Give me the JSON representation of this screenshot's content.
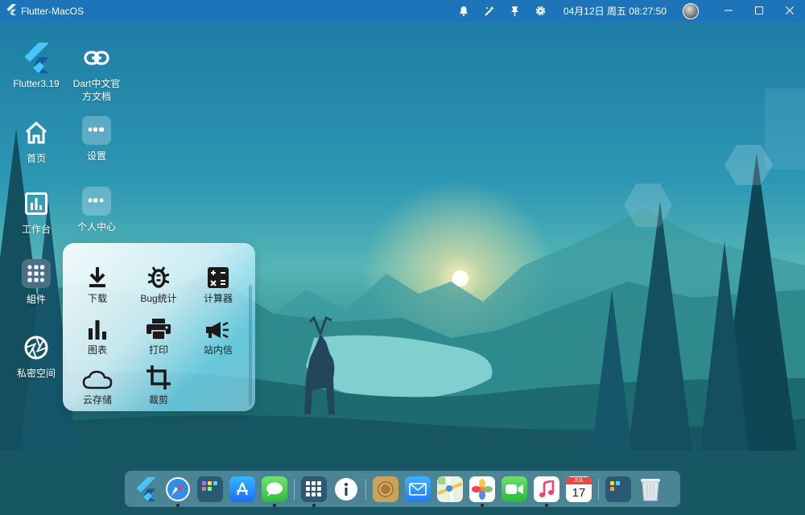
{
  "titlebar": {
    "title": "Flutter-MacOS",
    "clock": "04月12日 周五 08:27:50",
    "icons": [
      "bell-icon",
      "magic-wand-icon",
      "pin-icon",
      "gear-icon"
    ]
  },
  "desktop": {
    "icons": [
      {
        "name": "flutter",
        "label": "Flutter3.19",
        "icon": "flutter-logo-icon"
      },
      {
        "name": "dart-docs",
        "label": "Dart中文官方文档",
        "icon": "link-icon"
      },
      {
        "name": "home",
        "label": "首页",
        "icon": "home-icon"
      },
      {
        "name": "settings",
        "label": "设置",
        "icon": "folder-tile-icon"
      },
      {
        "name": "workbench",
        "label": "工作台",
        "icon": "chart-icon"
      },
      {
        "name": "profile",
        "label": "个人中心",
        "icon": "folder-tile-icon"
      },
      {
        "name": "components",
        "label": "組件",
        "icon": "folder-tile-icon"
      },
      {
        "name": "private-space",
        "label": "私密空间",
        "icon": "shutter-icon"
      }
    ]
  },
  "panel": {
    "items": [
      {
        "label": "下载",
        "icon": "download-icon"
      },
      {
        "label": "Bug统计",
        "icon": "bug-icon"
      },
      {
        "label": "计算器",
        "icon": "calculator-icon"
      },
      {
        "label": "图表",
        "icon": "bar-chart-icon"
      },
      {
        "label": "打印",
        "icon": "printer-icon"
      },
      {
        "label": "站内信",
        "icon": "megaphone-icon"
      },
      {
        "label": "云存储",
        "icon": "cloud-icon"
      },
      {
        "label": "裁剪",
        "icon": "crop-icon"
      }
    ]
  },
  "dock": {
    "items": [
      "flutter-icon",
      "safari-icon",
      "folder-icon",
      "app-store-icon",
      "messages-icon",
      "folder-icon",
      "info-icon",
      "coin-icon",
      "mail-icon",
      "maps-icon",
      "photos-icon",
      "facetime-icon",
      "music-icon",
      "calendar-icon",
      "folder-icon",
      "trash-icon"
    ],
    "calendar": {
      "month": "JUL",
      "day": "17"
    }
  },
  "colors": {
    "titlebar": "#1d74b8",
    "flutter_blue": "#47c5fb"
  }
}
